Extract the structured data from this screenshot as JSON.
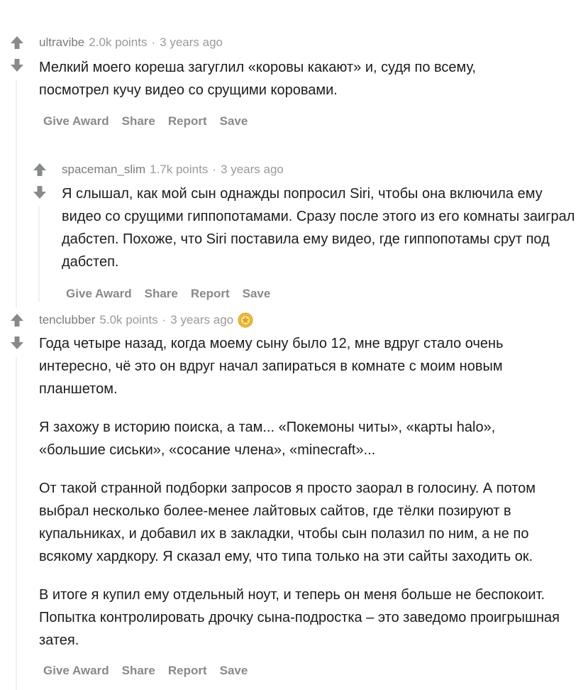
{
  "comments": [
    {
      "author": "ultravibe",
      "points": "2.0k points",
      "separator": "·",
      "time": "3 years ago",
      "body": [
        "Мелкий моего кореша загуглил «коровы какают» и, судя по всему, посмотрел кучу видео со срущими коровами."
      ],
      "actions": [
        "Give Award",
        "Share",
        "Report",
        "Save"
      ]
    },
    {
      "author": "spaceman_slim",
      "points": "1.7k points",
      "separator": "·",
      "time": "3 years ago",
      "body": [
        "Я слышал, как мой сын однажды попросил Siri, чтобы она включила ему видео со срущими гиппопотамами. Сразу после этого из его комнаты заиграл дабстеп. Похоже, что Siri поставила ему видео, где гиппопотамы срут под дабстеп."
      ],
      "actions": [
        "Give Award",
        "Share",
        "Report",
        "Save"
      ]
    },
    {
      "author": "tenclubber",
      "points": "5.0k points",
      "separator": "·",
      "time": "3 years ago",
      "award_icon": "award-icon",
      "body": [
        "Года четыре назад, когда моему сыну было 12, мне вдруг стало очень интересно, чё это он вдруг начал запираться в комнате с моим новым планшетом.",
        "Я захожу в историю поиска, а там... «Покемоны читы», «карты halo», «большие сиськи», «сосание члена», «minecraft»...",
        "От такой странной подборки запросов я просто заорал в голосину. А потом выбрал несколько более-менее лайтовых сайтов, где тёлки позируют в купальниках, и добавил их в закладки, чтобы сын полазил по ним, а не по всякому хардкору. Я сказал ему, что типа только на эти сайты заходить ок.",
        "В итоге я купил ему отдельный ноут, и теперь он меня больше не беспокоит. Попытка контролировать дрочку сына-подростка – это заведомо проигрышная затея."
      ],
      "actions": [
        "Give Award",
        "Share",
        "Report",
        "Save"
      ]
    }
  ],
  "icons": {
    "upvote": "upvote-arrow-icon",
    "downvote": "downvote-arrow-icon"
  },
  "colors": {
    "arrow": "#878a8c",
    "meta": "#7c7c7c",
    "action": "#878a8c",
    "thread_line": "#edeff1",
    "award": "#f5c33b"
  }
}
